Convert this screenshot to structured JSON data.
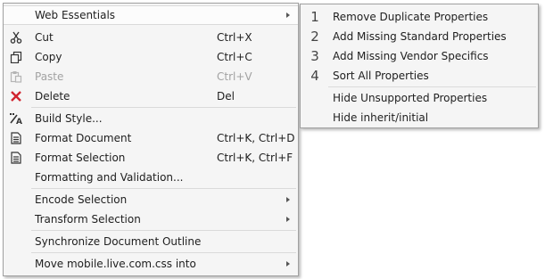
{
  "main_menu": {
    "web_essentials": {
      "label": "Web Essentials"
    },
    "cut": {
      "label": "Cut",
      "shortcut": "Ctrl+X",
      "icon": "scissors-icon"
    },
    "copy": {
      "label": "Copy",
      "shortcut": "Ctrl+C",
      "icon": "copy-icon"
    },
    "paste": {
      "label": "Paste",
      "shortcut": "Ctrl+V",
      "icon": "paste-icon",
      "disabled": true
    },
    "delete": {
      "label": "Delete",
      "shortcut": "Del",
      "icon": "delete-x-icon"
    },
    "build_style": {
      "label": "Build Style...",
      "icon": "build-style-icon"
    },
    "format_document": {
      "label": "Format Document",
      "shortcut": "Ctrl+K, Ctrl+D",
      "icon": "format-document-icon"
    },
    "format_selection": {
      "label": "Format Selection",
      "shortcut": "Ctrl+K, Ctrl+F",
      "icon": "format-selection-icon"
    },
    "formatting_validation": {
      "label": "Formatting and Validation..."
    },
    "encode_selection": {
      "label": "Encode Selection"
    },
    "transform_selection": {
      "label": "Transform Selection"
    },
    "synchronize_outline": {
      "label": "Synchronize Document Outline"
    },
    "move_into": {
      "label": "Move mobile.live.com.css into"
    }
  },
  "sub_menu": {
    "remove_duplicate": {
      "num": "1",
      "label": "Remove Duplicate Properties"
    },
    "add_missing_standard": {
      "num": "2",
      "label": "Add Missing Standard Properties"
    },
    "add_missing_vendor": {
      "num": "3",
      "label": "Add Missing Vendor Specifics"
    },
    "sort_all": {
      "num": "4",
      "label": "Sort All Properties"
    },
    "hide_unsupported": {
      "label": "Hide Unsupported Properties"
    },
    "hide_inherit": {
      "label": "Hide inherit/initial"
    }
  },
  "colors": {
    "menu_background": "#f5f5f5",
    "menu_border": "#a0a0a0",
    "separator": "#dadada",
    "disabled_text": "#a2a2a2",
    "delete_icon": "#d1242f"
  }
}
